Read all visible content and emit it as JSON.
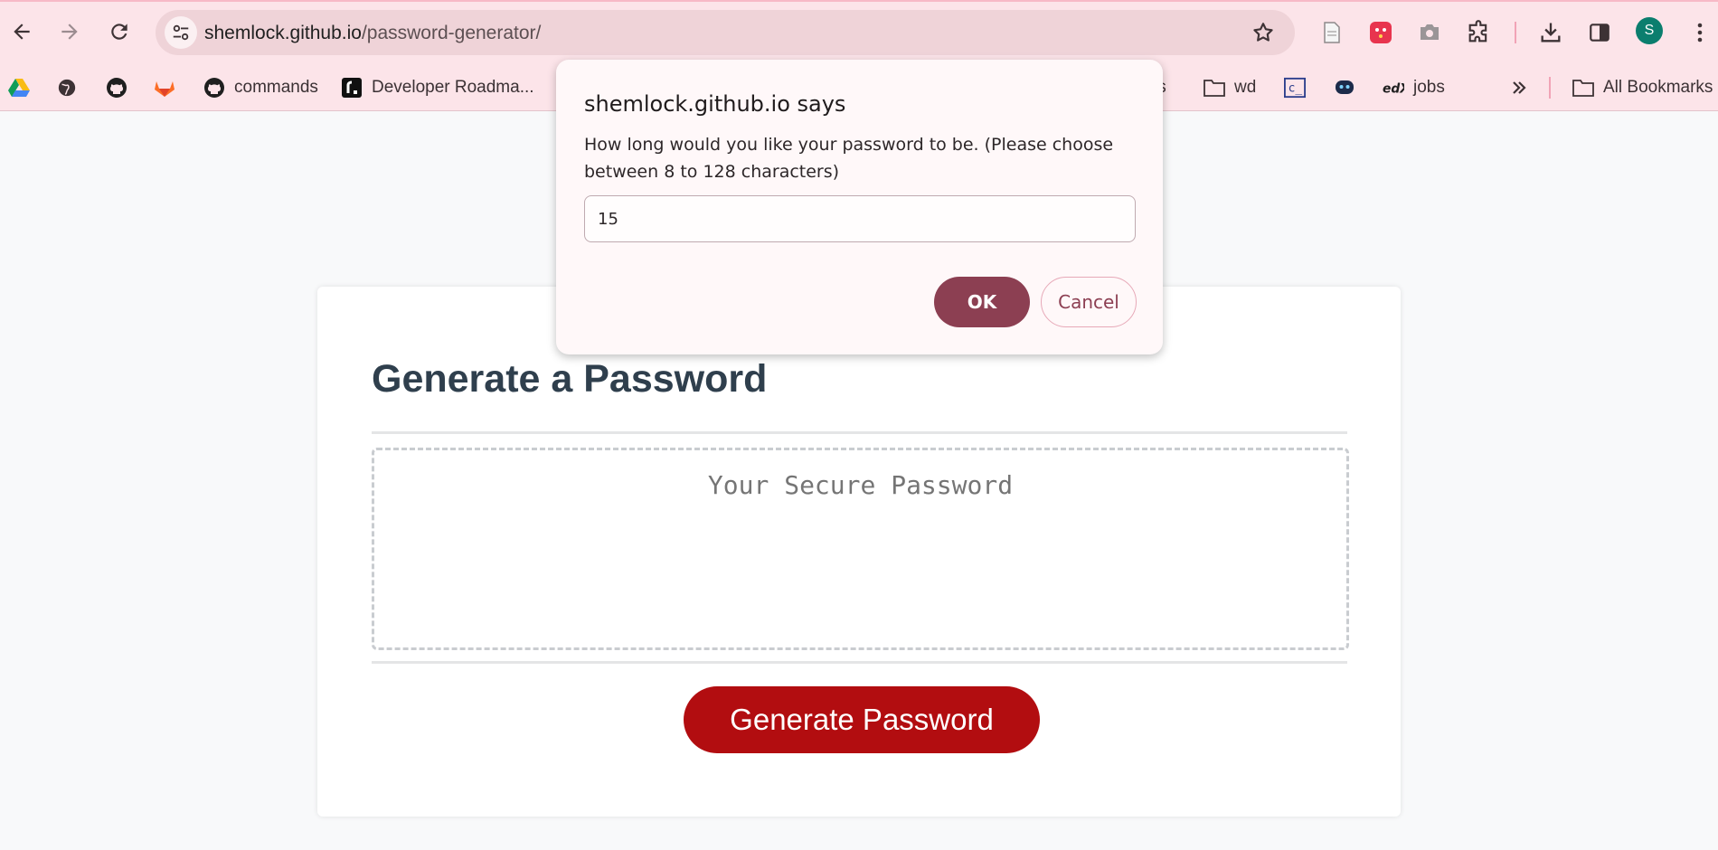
{
  "browser": {
    "url_host": "shemlock.github.io",
    "url_path": "/password-generator/",
    "profile_initial": "S",
    "accent_color": "#fce4e9",
    "toolbar_icons": [
      "back-icon",
      "forward-icon",
      "reload-icon",
      "site-settings-icon",
      "star-icon",
      "document-icon",
      "extension-app-icon",
      "camera-icon",
      "extensions-icon",
      "download-icon",
      "side-panel-icon"
    ]
  },
  "bookmarks": {
    "items": [
      {
        "label": "",
        "icon": "google-drive-icon"
      },
      {
        "label": "",
        "icon": "globe-icon"
      },
      {
        "label": "",
        "icon": "github-icon"
      },
      {
        "label": "",
        "icon": "gitlab-icon"
      },
      {
        "label": "commands",
        "icon": "github-icon"
      },
      {
        "label": "Developer Roadma...",
        "icon": "roadmap-icon"
      },
      {
        "label": "js",
        "icon": "bookmark-icon"
      },
      {
        "label": "wd",
        "icon": "folder-icon"
      },
      {
        "label": "",
        "icon": "code-icon"
      },
      {
        "label": "",
        "icon": "bot-icon"
      },
      {
        "label": "jobs",
        "icon": "edx-icon"
      }
    ],
    "overflow_icon": "chevron-double-right-icon",
    "all_bookmarks_label": "All Bookmarks"
  },
  "page": {
    "heading": "Generate a Password",
    "password_placeholder": "Your Secure Password",
    "generate_button_label": "Generate Password",
    "button_color": "#b20d10"
  },
  "dialog": {
    "title": "shemlock.github.io says",
    "message": "How long would you like your password to be. (Please choose between 8 to 128 characters)",
    "input_value": "15",
    "ok_label": "OK",
    "cancel_label": "Cancel"
  }
}
